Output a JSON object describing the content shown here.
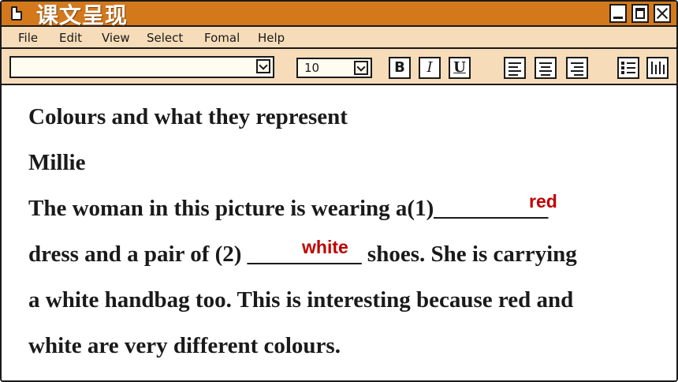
{
  "window": {
    "title": "课文呈现"
  },
  "menu": {
    "items": [
      "File",
      "Edit",
      "View",
      "Select",
      "Fomal",
      "Help"
    ]
  },
  "toolbar": {
    "font_value": "",
    "size_value": "10",
    "bold_label": "B",
    "italic_label": "I",
    "underline_label": "U"
  },
  "content": {
    "title": "Colours and what they represent",
    "author": "Millie",
    "line1": "The woman in this picture is wearing a(1)__________",
    "line2": "dress and a pair of (2) __________ shoes. She is carrying",
    "line3": "a white handbag too. This is interesting because red and",
    "line4": "white are very different colours.",
    "answer1": "red",
    "answer2": "white"
  },
  "colors": {
    "titlebar": "#d4781c",
    "menubar": "#f6dcb8",
    "answer": "#c00000"
  }
}
